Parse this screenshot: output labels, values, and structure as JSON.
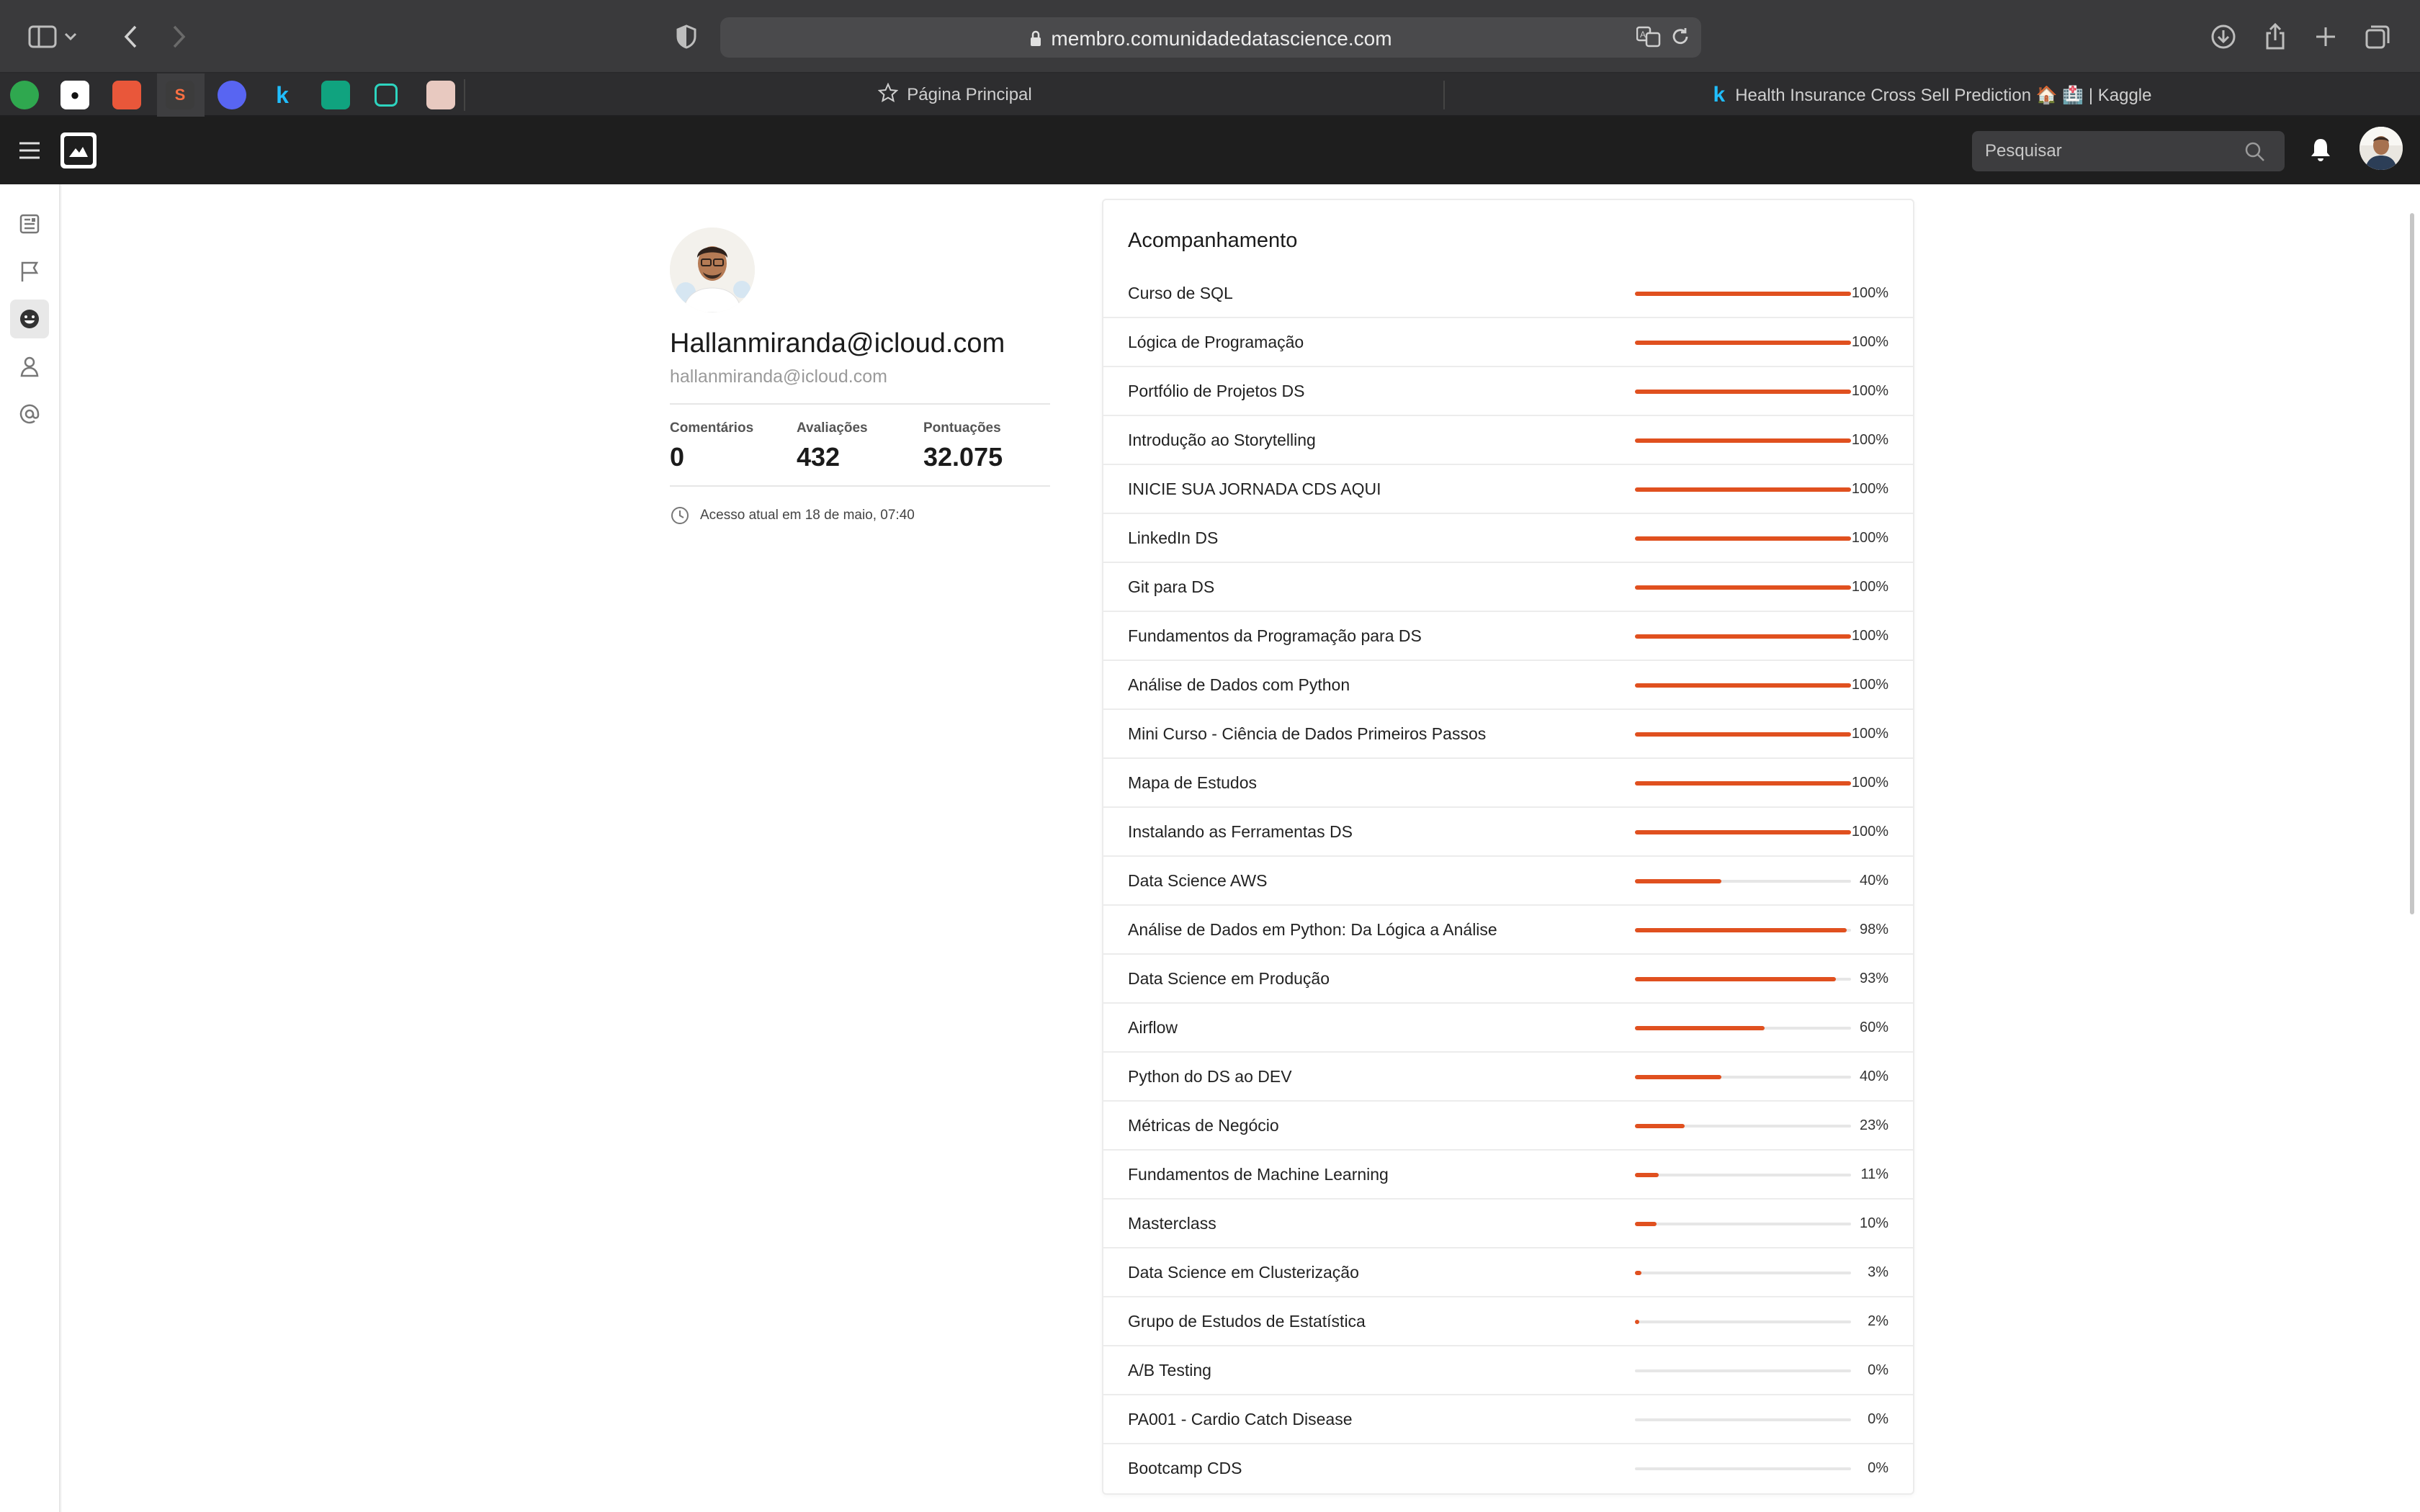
{
  "browser": {
    "url": "membro.comunidadedatascience.com",
    "tabs": [
      {
        "title": "Página Principal"
      },
      {
        "title": "Health Insurance Cross Sell Prediction 🏠 🏥 | Kaggle"
      }
    ],
    "pinned_tabs": [
      {
        "icon": "green-app-icon",
        "letter": "",
        "color": "#2fa84f"
      },
      {
        "icon": "github-icon",
        "letter": "",
        "color": "#ffffff"
      },
      {
        "icon": "flame-app-icon",
        "letter": "",
        "color": "#e9573a"
      },
      {
        "icon": "s-logo-icon",
        "letter": "S",
        "color": "#3c3c3c"
      },
      {
        "icon": "discord-icon",
        "letter": "",
        "color": "#5865f2"
      },
      {
        "icon": "kaggle-icon",
        "letter": "k",
        "color": "#20beff"
      },
      {
        "icon": "openai-icon",
        "letter": "",
        "color": "#10a37f"
      },
      {
        "icon": "crop-app-icon",
        "letter": "",
        "color": "#2dd4bf"
      },
      {
        "icon": "pink-app-icon",
        "letter": "",
        "color": "#e8c9c0"
      }
    ]
  },
  "header": {
    "search_placeholder": "Pesquisar"
  },
  "profile": {
    "name": "Hallanmiranda@icloud.com",
    "email": "hallanmiranda@icloud.com",
    "stats": [
      {
        "label": "Comentários",
        "value": "0"
      },
      {
        "label": "Avaliações",
        "value": "432"
      },
      {
        "label": "Pontuações",
        "value": "32.075"
      }
    ],
    "last_access": "Acesso atual em 18 de maio, 07:40"
  },
  "progress": {
    "title": "Acompanhamento",
    "accent_color": "#e0501f",
    "items": [
      {
        "name": "Curso de SQL",
        "percent": 100,
        "label": "100%"
      },
      {
        "name": "Lógica de Programação",
        "percent": 100,
        "label": "100%"
      },
      {
        "name": "Portfólio de Projetos DS",
        "percent": 100,
        "label": "100%"
      },
      {
        "name": "Introdução ao Storytelling",
        "percent": 100,
        "label": "100%"
      },
      {
        "name": "INICIE SUA JORNADA CDS AQUI",
        "percent": 100,
        "label": "100%"
      },
      {
        "name": "LinkedIn DS",
        "percent": 100,
        "label": "100%"
      },
      {
        "name": "Git para DS",
        "percent": 100,
        "label": "100%"
      },
      {
        "name": "Fundamentos da Programação para DS",
        "percent": 100,
        "label": "100%"
      },
      {
        "name": "Análise de Dados com Python",
        "percent": 100,
        "label": "100%"
      },
      {
        "name": "Mini Curso - Ciência de Dados Primeiros Passos",
        "percent": 100,
        "label": "100%"
      },
      {
        "name": "Mapa de Estudos",
        "percent": 100,
        "label": "100%"
      },
      {
        "name": "Instalando as Ferramentas DS",
        "percent": 100,
        "label": "100%"
      },
      {
        "name": "Data Science AWS",
        "percent": 40,
        "label": "40%"
      },
      {
        "name": "Análise de Dados em Python: Da Lógica a Análise",
        "percent": 98,
        "label": "98%"
      },
      {
        "name": "Data Science em Produção",
        "percent": 93,
        "label": "93%"
      },
      {
        "name": "Airflow",
        "percent": 60,
        "label": "60%"
      },
      {
        "name": "Python do DS ao DEV",
        "percent": 40,
        "label": "40%"
      },
      {
        "name": "Métricas de Negócio",
        "percent": 23,
        "label": "23%"
      },
      {
        "name": "Fundamentos de Machine Learning",
        "percent": 11,
        "label": "11%"
      },
      {
        "name": "Masterclass",
        "percent": 10,
        "label": "10%"
      },
      {
        "name": "Data Science em Clusterização",
        "percent": 3,
        "label": "3%"
      },
      {
        "name": "Grupo de Estudos de Estatística",
        "percent": 2,
        "label": "2%"
      },
      {
        "name": "A/B Testing",
        "percent": 0,
        "label": "0%"
      },
      {
        "name": "PA001 - Cardio Catch Disease",
        "percent": 0,
        "label": "0%"
      },
      {
        "name": "Bootcamp CDS",
        "percent": 0,
        "label": "0%"
      }
    ]
  }
}
